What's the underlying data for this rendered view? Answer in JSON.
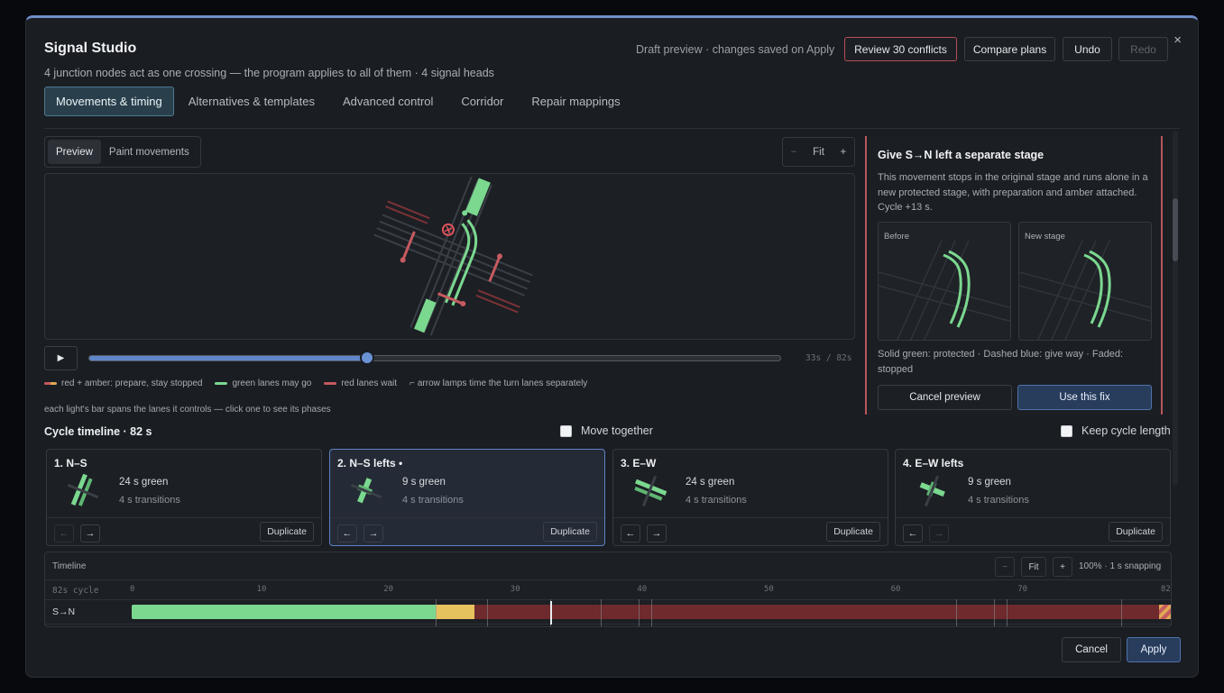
{
  "app": {
    "title": "Signal Studio",
    "subtitle": "4 junction nodes act as one crossing — the program applies to all of them · 4 signal heads",
    "close_label": "×"
  },
  "toolbar": {
    "draft": "Draft preview · changes saved on Apply",
    "conflicts_label": "Review 30 conflicts",
    "compare_label": "Compare plans",
    "undo_label": "Undo",
    "redo_label": "Redo"
  },
  "tabs": [
    {
      "label": "Movements & timing",
      "active": true
    },
    {
      "label": "Alternatives & templates"
    },
    {
      "label": "Advanced control"
    },
    {
      "label": "Corridor"
    },
    {
      "label": "Repair mappings"
    }
  ],
  "view": {
    "modes": [
      {
        "label": "Preview",
        "active": true
      },
      {
        "label": "Paint movements"
      }
    ],
    "zoom_minus": "−",
    "zoom_fit": "Fit",
    "zoom_plus": "+"
  },
  "playback": {
    "play_icon": "▶",
    "position_s": 33,
    "cycle_s": 82,
    "readout": "33s / 82s"
  },
  "legend": [
    {
      "label": "red + amber: prepare, stay stopped",
      "color": "#e0a955"
    },
    {
      "label": "green lanes may go",
      "color": "#7bd88f"
    },
    {
      "label": "red lanes wait",
      "color": "#c55a5f"
    },
    {
      "label": "arrow lamps time the turn lanes separately",
      "icon": "turn-arrow-icon"
    }
  ],
  "hint": "each light's bar spans the lanes it controls — click one to see its phases",
  "fix_panel": {
    "title": "Give S→N left a separate stage",
    "description": "This movement stops in the original stage and runs alone in a new protected stage, with preparation and amber attached. Cycle +13 s.",
    "before_label": "Before",
    "after_label": "New stage",
    "note": "Solid green: protected · Dashed blue: give way · Faded: stopped",
    "cancel_label": "Cancel preview",
    "apply_label": "Use this fix"
  },
  "cycle": {
    "title": "Cycle timeline · 82 s",
    "move_together": "Move together",
    "keep_length": "Keep cycle length"
  },
  "stages": [
    {
      "name": "1. N–S",
      "green": "24 s green",
      "transitions": "4 s transitions",
      "duplicate": "Duplicate",
      "left": "←",
      "right": "→"
    },
    {
      "name": "2. N–S lefts •",
      "green": "9 s green",
      "transitions": "4 s transitions",
      "duplicate": "Duplicate",
      "left": "←",
      "right": "→"
    },
    {
      "name": "3. E–W",
      "green": "24 s green",
      "transitions": "4 s transitions",
      "duplicate": "Duplicate",
      "left": "←",
      "right": "→"
    },
    {
      "name": "4. E–W lefts",
      "green": "9 s green",
      "transitions": "4 s transitions",
      "duplicate": "Duplicate",
      "left": "←",
      "right": "→"
    }
  ],
  "timeline": {
    "label": "Timeline",
    "minus": "−",
    "fit": "Fit",
    "plus": "+",
    "snap": "100% · 1 s snapping",
    "cycle_label": "82s cycle",
    "ticks": [
      "0",
      "10",
      "20",
      "30",
      "40",
      "50",
      "60",
      "70",
      "82"
    ],
    "tick_values": [
      0,
      10,
      20,
      30,
      40,
      50,
      60,
      70,
      82
    ],
    "row_label": "S→N",
    "segments": [
      {
        "start": 0,
        "end": 24,
        "state": "green",
        "color": "#7bd88f"
      },
      {
        "start": 24,
        "end": 27,
        "state": "amber",
        "color": "#e6c25e"
      },
      {
        "start": 27,
        "end": 81,
        "state": "red",
        "color": "#6e2a2c"
      },
      {
        "start": 81,
        "end": 82,
        "state": "red-amber",
        "color": "#d9883f"
      }
    ],
    "markers": [
      24,
      28,
      33,
      37,
      40,
      41,
      65,
      68,
      69,
      78
    ]
  },
  "footer": {
    "cancel_label": "Cancel",
    "apply_label": "Apply"
  }
}
